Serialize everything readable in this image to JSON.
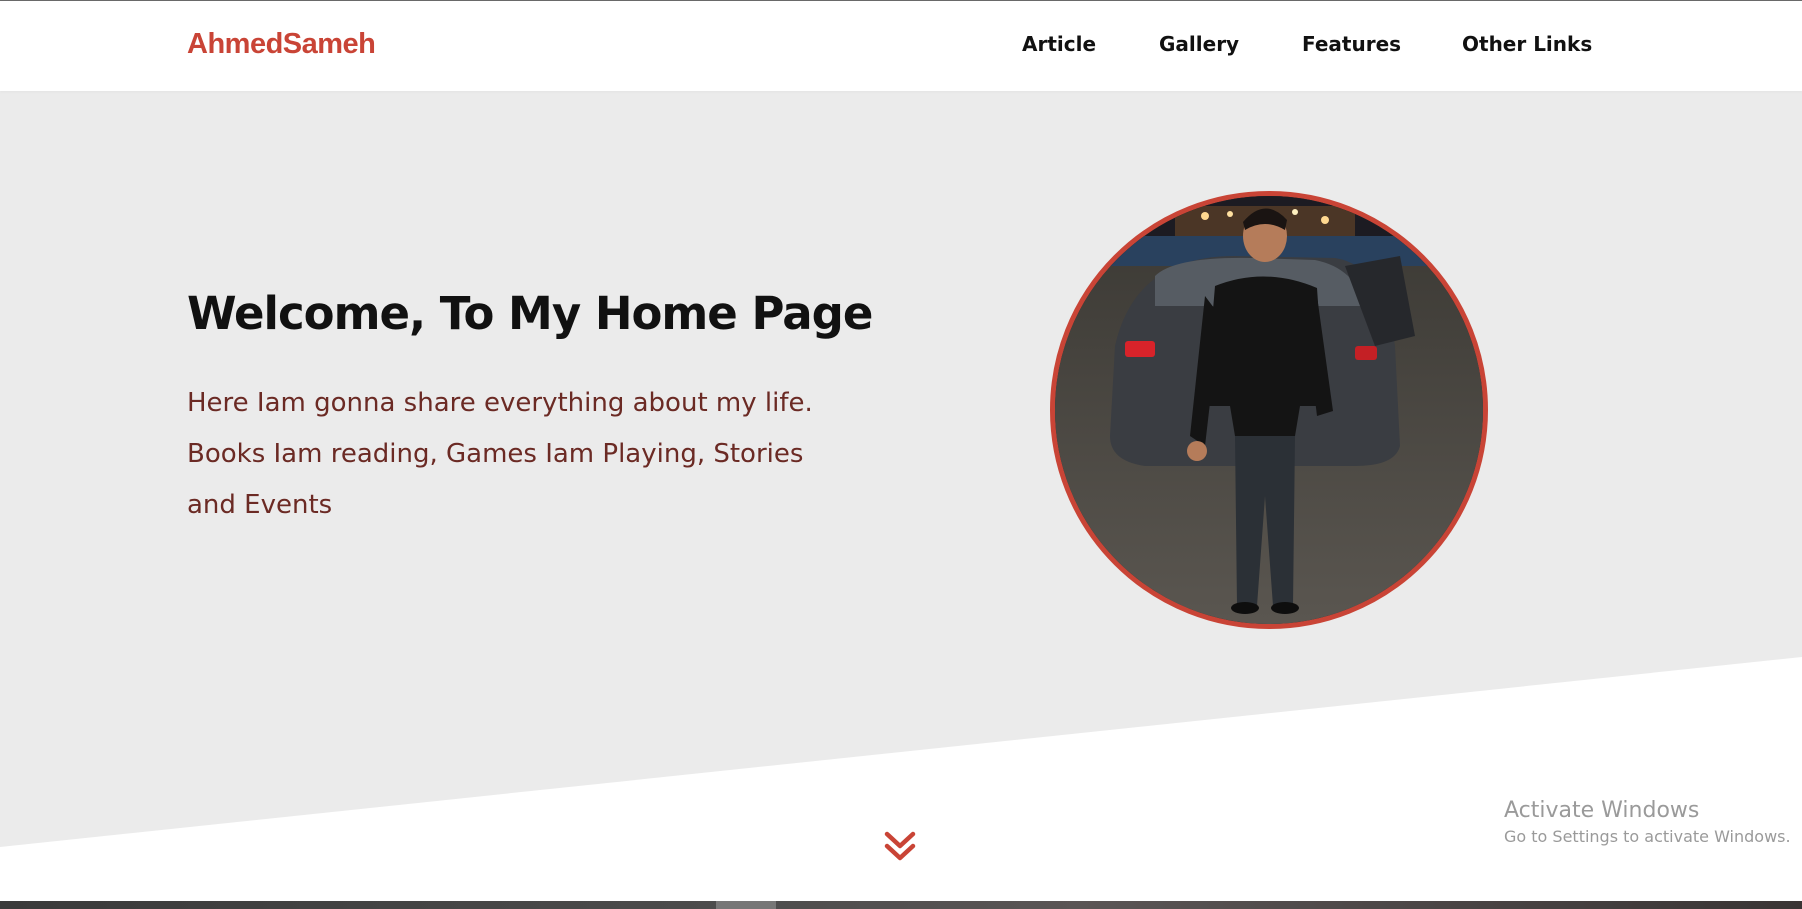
{
  "header": {
    "logo": "AhmedSameh",
    "nav": [
      {
        "label": "Article"
      },
      {
        "label": "Gallery"
      },
      {
        "label": "Features"
      },
      {
        "label": "Other Links"
      }
    ]
  },
  "hero": {
    "title": "Welcome, To My Home Page",
    "description_lines": [
      "Here Iam gonna share everything about my life.",
      "Books Iam reading, Games Iam Playing, Stories",
      "and Events"
    ]
  },
  "scroll": {
    "icon": "double-chevron-down-icon"
  },
  "watermark": {
    "line1": "Activate Windows",
    "line2": "Go to Settings to activate Windows."
  },
  "colors": {
    "accent": "#c94436",
    "hero_bg": "#ebebeb",
    "text_dark": "#111111",
    "description": "#6b2a24"
  }
}
